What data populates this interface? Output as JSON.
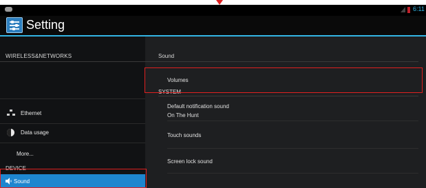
{
  "status_bar": {
    "time": "6:11"
  },
  "action_bar": {
    "title": "Setting"
  },
  "left_pane": {
    "section_wireless": "WIRELESS&NETWORKS",
    "items": [
      {
        "label": "Ethernet",
        "icon": "ethernet-icon"
      },
      {
        "label": "Data usage",
        "icon": "data-usage-icon"
      },
      {
        "label": "More..."
      }
    ],
    "section_device": "DEVICE",
    "selected_item": {
      "label": "Sound",
      "icon": "volume-icon"
    }
  },
  "right_pane": {
    "section_sound": "Sound",
    "volumes_label": "Volumes",
    "section_system": "SYSTEM",
    "default_notification": {
      "title": "Default notification sound",
      "value": "On The Hunt"
    },
    "touch_sounds": "Touch sounds",
    "screen_lock_sound": "Screen lock sound"
  },
  "colors": {
    "accent": "#33b5e5",
    "selected_bg": "#1e86cf",
    "highlight_box": "#e02020"
  }
}
